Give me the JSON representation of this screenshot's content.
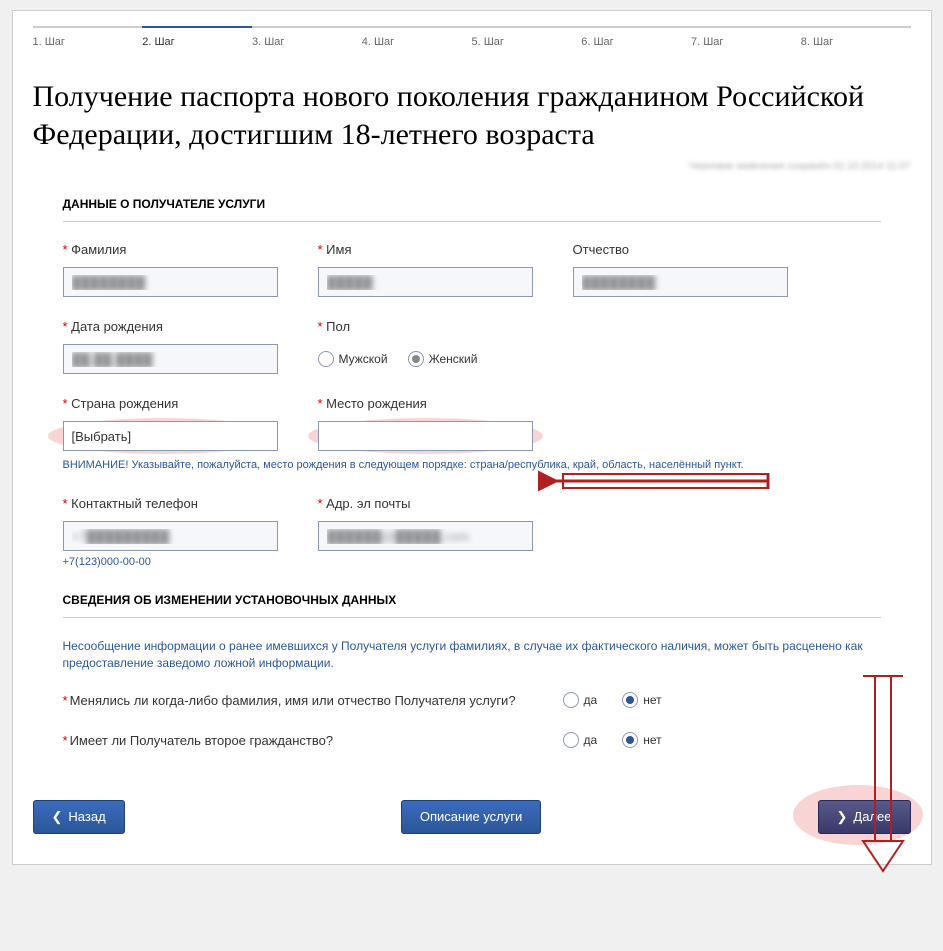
{
  "steps": [
    "1. Шаг",
    "2. Шаг",
    "3. Шаг",
    "4. Шаг",
    "5. Шаг",
    "6. Шаг",
    "7. Шаг",
    "8. Шаг"
  ],
  "active_step": 1,
  "title": "Получение паспорта нового поколения гражданином Российской Федерации, достигшим 18-летнего возраста",
  "draft": "Черновик заявления сохранён 02.10.2014 11:07",
  "section1": "ДАННЫЕ О ПОЛУЧАТЕЛЕ УСЛУГИ",
  "labels": {
    "surname": "Фамилия",
    "name": "Имя",
    "patronymic": "Отчество",
    "dob": "Дата рождения",
    "gender": "Пол",
    "male": "Мужской",
    "female": "Женский",
    "country": "Страна рождения",
    "place": "Место рождения",
    "phone": "Контактный телефон",
    "email": "Адр. эл почты"
  },
  "values": {
    "surname": "████████",
    "name": "█████",
    "patronymic": "████████",
    "dob": "██.██.████",
    "country": "[Выбрать]",
    "place": "",
    "phone": "+7█████████",
    "email": "██████@█████.com"
  },
  "place_hint": "ВНИМАНИЕ! Указывайте, пожалуйста, место рождения в следующем порядке: страна/республика, край, область, населённый пункт.",
  "phone_hint": "+7(123)000-00-00",
  "section2": "СВЕДЕНИЯ ОБ ИЗМЕНЕНИИ УСТАНОВОЧНЫХ ДАННЫХ",
  "section2_info": "Несообщение информации о ранее имевшихся у Получателя услуги фамилиях, в случае их фактического наличия, может быть расценено как предоставление заведомо ложной информации.",
  "q1": "Менялись ли когда-либо фамилия, имя или отчество Получателя услуги?",
  "q2": "Имеет ли Получатель второе гражданство?",
  "yes": "да",
  "no": "нет",
  "btn_back": "Назад",
  "btn_desc": "Описание услуги",
  "btn_next": "Далее"
}
